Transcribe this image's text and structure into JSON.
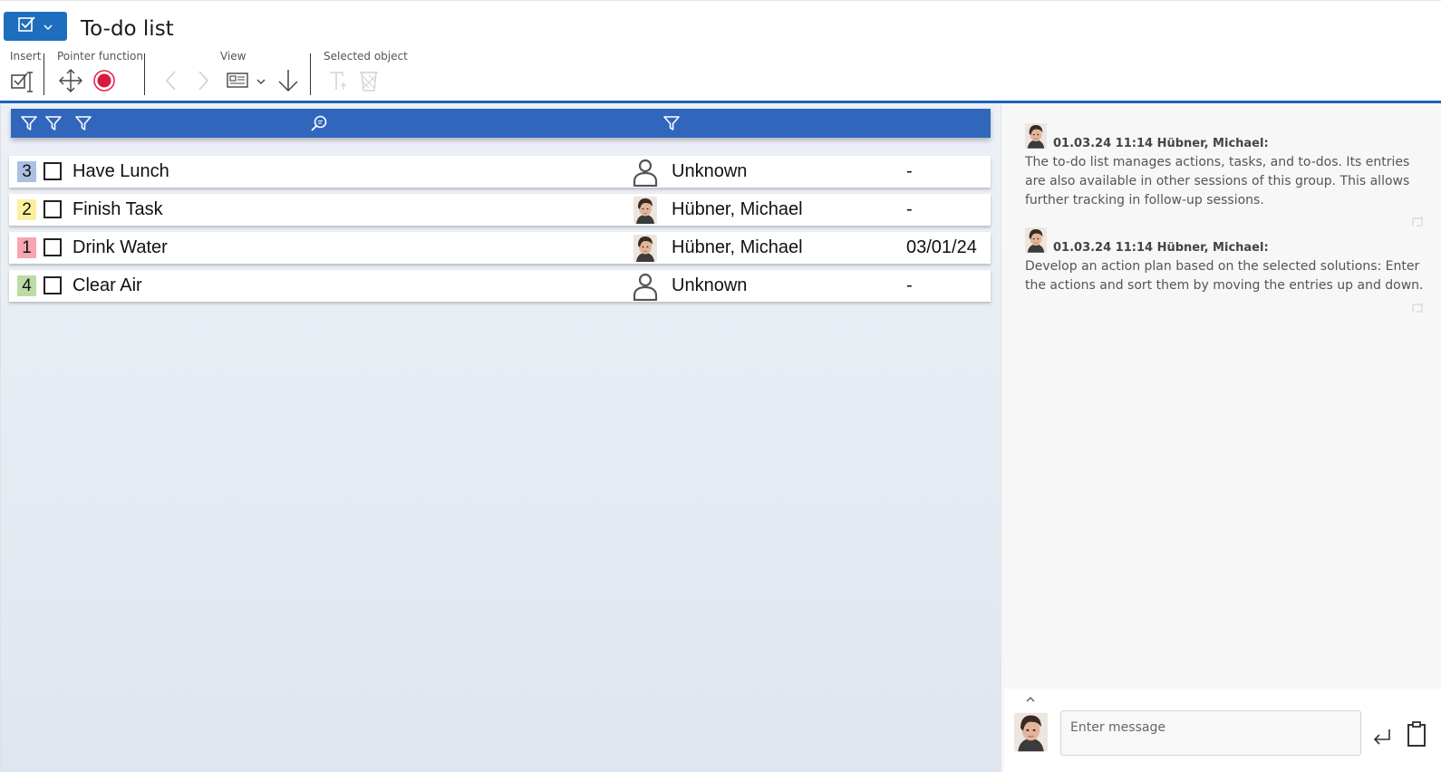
{
  "header": {
    "title": "To-do list",
    "groups": {
      "insert": "Insert",
      "pointer": "Pointer function",
      "view": "View",
      "selected": "Selected object"
    }
  },
  "todos": [
    {
      "priority": "3",
      "priority_color": "#a9c0e3",
      "title": "Have Lunch",
      "owner": "Unknown",
      "owner_type": "person-icon",
      "due": "-"
    },
    {
      "priority": "2",
      "priority_color": "#fbf0a0",
      "title": "Finish Task",
      "owner": "Hübner, Michael",
      "owner_type": "photo",
      "due": "-"
    },
    {
      "priority": "1",
      "priority_color": "#f5a6b2",
      "title": "Drink Water",
      "owner": "Hübner, Michael",
      "owner_type": "photo",
      "due": "03/01/24"
    },
    {
      "priority": "4",
      "priority_color": "#bcdca7",
      "title": "Clear Air",
      "owner": "Unknown",
      "owner_type": "person-icon",
      "due": "-"
    }
  ],
  "comments": [
    {
      "meta": "01.03.24 11:14 Hübner, Michael:",
      "text": "The to-do list manages actions, tasks, and to-dos. Its entries are also available in other sessions of this group. This allows further tracking in follow-up sessions."
    },
    {
      "meta": "01.03.24 11:14 Hübner, Michael:",
      "text": "Develop an action plan based on the selected solutions: Enter the actions and sort them by moving the entries up and down."
    }
  ],
  "composer": {
    "placeholder": "Enter message"
  },
  "colors": {
    "accent": "#1d6fbd",
    "filter_bar": "#3166bd",
    "header_line": "#1d63b8"
  }
}
